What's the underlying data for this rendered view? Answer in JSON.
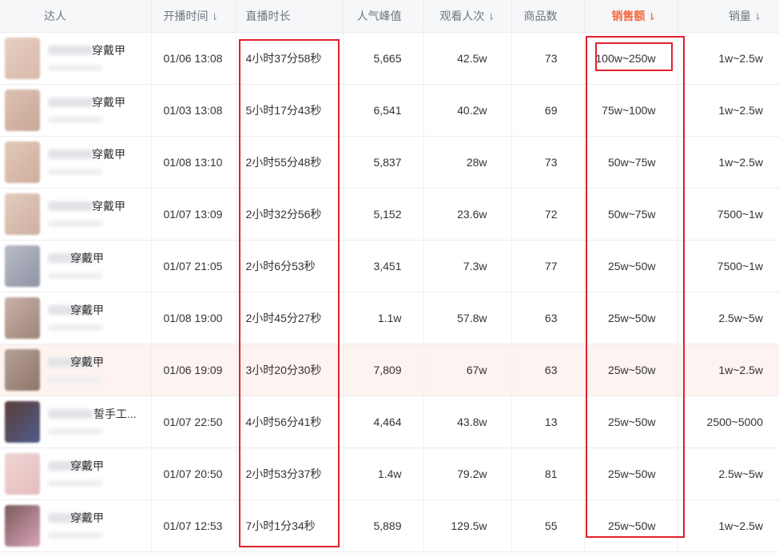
{
  "headers": {
    "anchor": "达人",
    "start_time": "开播时间",
    "duration": "直播时长",
    "peak": "人气峰值",
    "viewers": "观看人次",
    "goods": "商品数",
    "sales": "销售额",
    "volume": "销量",
    "sort_icon": "sort-down-arrow"
  },
  "colors": {
    "accent": "#f36a3c",
    "highlight_box": "#e0212c",
    "header_bg": "#f6f7f9",
    "highlight_row": "#fdf3f1"
  },
  "rows": [
    {
      "name": "穿戴甲",
      "start": "01/06 13:08",
      "duration": "4小时37分58秒",
      "peak": "5,665",
      "viewers": "42.5w",
      "goods": "73",
      "sales": "100w~250w",
      "volume": "1w~2.5w",
      "avatar": [
        "#e8cfc4",
        "#d6b9a8"
      ]
    },
    {
      "name": "穿戴甲",
      "start": "01/03 13:08",
      "duration": "5小时17分43秒",
      "peak": "6,541",
      "viewers": "40.2w",
      "goods": "69",
      "sales": "75w~100w",
      "volume": "1w~2.5w",
      "avatar": [
        "#dcc1b3",
        "#c9a896"
      ]
    },
    {
      "name": "穿戴甲",
      "start": "01/08 13:10",
      "duration": "2小时55分48秒",
      "peak": "5,837",
      "viewers": "28w",
      "goods": "73",
      "sales": "50w~75w",
      "volume": "1w~2.5w",
      "avatar": [
        "#e2c8ba",
        "#cfae9b"
      ]
    },
    {
      "name": "穿戴甲",
      "start": "01/07 13:09",
      "duration": "2小时32分56秒",
      "peak": "5,152",
      "viewers": "23.6w",
      "goods": "72",
      "sales": "50w~75w",
      "volume": "7500~1w",
      "avatar": [
        "#e4cbbd",
        "#cdb0a0"
      ]
    },
    {
      "name": "穿戴甲",
      "start": "01/07 21:05",
      "duration": "2小时6分53秒",
      "peak": "3,451",
      "viewers": "7.3w",
      "goods": "77",
      "sales": "25w~50w",
      "volume": "7500~1w",
      "avatar": [
        "#b9bcc8",
        "#8f93a3"
      ]
    },
    {
      "name": "穿戴甲",
      "start": "01/08 19:00",
      "duration": "2小时45分27秒",
      "peak": "1.1w",
      "viewers": "57.8w",
      "goods": "63",
      "sales": "25w~50w",
      "volume": "2.5w~5w",
      "avatar": [
        "#c7b1a8",
        "#9e8478"
      ]
    },
    {
      "name": "穿戴甲",
      "start": "01/06 19:09",
      "duration": "3小时20分30秒",
      "peak": "7,809",
      "viewers": "67w",
      "goods": "63",
      "sales": "25w~50w",
      "volume": "1w~2.5w",
      "avatar": [
        "#b59e94",
        "#8e766b"
      ]
    },
    {
      "name": "誓手工...",
      "start": "01/07 22:50",
      "duration": "4小时56分41秒",
      "peak": "4,464",
      "viewers": "43.8w",
      "goods": "13",
      "sales": "25w~50w",
      "volume": "2500~5000",
      "avatar": [
        "#5a3f3a",
        "#4f5a8a"
      ]
    },
    {
      "name": "穿戴甲",
      "start": "01/07 20:50",
      "duration": "2小时53分37秒",
      "peak": "1.4w",
      "viewers": "79.2w",
      "goods": "81",
      "sales": "25w~50w",
      "volume": "2.5w~5w",
      "avatar": [
        "#f0d4d4",
        "#e4bcbc"
      ]
    },
    {
      "name": "穿戴甲",
      "start": "01/07 12:53",
      "duration": "7小时1分34秒",
      "peak": "5,889",
      "viewers": "129.5w",
      "goods": "55",
      "sales": "25w~50w",
      "volume": "1w~2.5w",
      "avatar": [
        "#7a5a58",
        "#d9a3bb"
      ]
    }
  ]
}
